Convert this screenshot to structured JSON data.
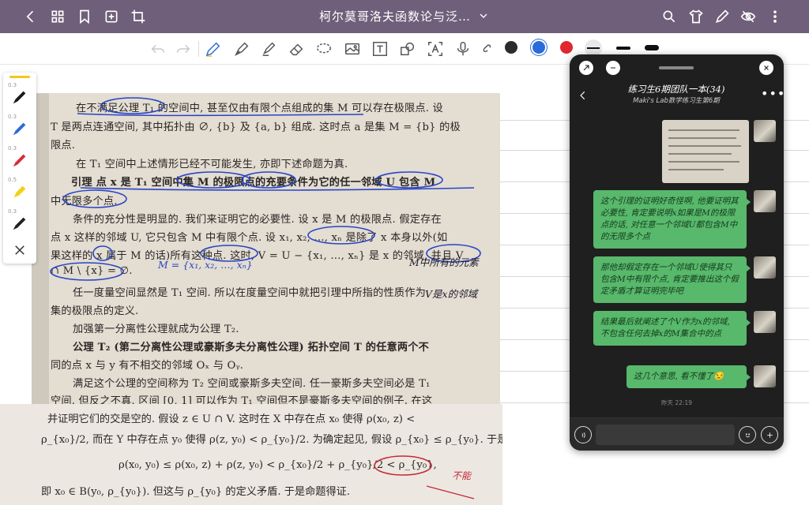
{
  "app": {
    "document_title": "柯尔莫哥洛夫函数论与泛…"
  },
  "toolbar": {
    "colors": [
      {
        "name": "black",
        "hex": "#2b2b2b"
      },
      {
        "name": "blue",
        "hex": "#2a6bd9",
        "selected": true
      },
      {
        "name": "red",
        "hex": "#e0262f"
      }
    ]
  },
  "page1": {
    "lines": [
      "在不满足公理 T₁ 的空间中, 甚至仅由有限个点组成的集 M 可以存在极限点. 设",
      "T 是两点连通空间, 其中拓扑由 ∅, {b} 及 {a, b} 组成. 这时点 a 是集 M = {b} 的极",
      "限点.",
      "在 T₁ 空间中上述情形已经不可能发生, 亦即下述命题为真.",
      "引理   点 x 是 T₁ 空间中集 M 的极限点的充要条件为它的任一邻域 U 包含 M",
      "中无限多个点.",
      "条件的充分性是明显的. 我们来证明它的必要性. 设 x 是 M 的极限点. 假定存在",
      "点 x 这样的邻域 U, 它只包含 M 中有限个点. 设 x₁, x₂, …, xₙ 是除了 x 本身以外(如",
      "果这样的 x 属于 M 的话)所有这种点. 这时, V = U − {x₁, …, xₙ} 是 x 的邻域, 并且 V",
      "∩ M \\ {x} = ∅.",
      "任一度量空间显然是 T₁ 空间. 所以在度量空间中就把引理中所指的性质作为",
      "集的极限点的定义.",
      "加强第一分离性公理就成为公理 T₂.",
      "公理 T₂ (第二分离性公理或豪斯多夫分离性公理)   拓扑空间 T 的任意两个不",
      "同的点 x 与 y 有不相交的邻域 Oₓ 与 Oᵧ.",
      "满足这个公理的空间称为 T₂ 空间或豪斯多夫空间. 任一豪斯多夫空间必是 T₁",
      "空间. 但反之不真. 区间 [0, 1] 可以作为 T₁ 空间但不是豪斯多夫空间的例子. 在这"
    ],
    "handwritten": [
      "M = {x₁, x₂, …, xₙ}",
      "M中所有的元素",
      "V是x的邻域"
    ]
  },
  "page2": {
    "lines": [
      "并证明它们的交是空的. 假设 z ∈ U ∩ V. 这时在 X 中存在点 x₀ 使得 ρ(x₀, z) <",
      "ρ_{x₀}/2, 而在 Y 中存在点 y₀ 使得 ρ(z, y₀) < ρ_{y₀}/2. 为确定起见, 假设 ρ_{x₀} ≤ ρ_{y₀}. 于是",
      "ρ(x₀, y₀) ≤ ρ(x₀, z) + ρ(z, y₀) < ρ_{x₀}/2 + ρ_{y₀}/2 < ρ_{y₀},",
      "即 x₀ ∈ B(y₀, ρ_{y₀}). 但这与 ρ_{y₀} 的定义矛盾. 于是命题得证."
    ],
    "handwritten_red": "不能"
  },
  "chat": {
    "title": "练习生6期团队一本(34)",
    "subtitle": "Maki's Lab数学练习生第6期",
    "messages": [
      "这个引理的证明好奇怪啊, 他要证明其必要性, 肯定要说明x如果是M的极限点的话, 对任意一个邻域U都包含M中的无限多个点",
      "那他却假定存在一个邻域U使得其只包含M中有限个点, 肯定要推出这个假定矛盾才算证明完毕吧",
      "结果最后就阐述了个V作为x的邻域, 不包含任何去掉x的M集合中的点",
      "这几个意思, 看不懂了😒"
    ],
    "timestamp": "昨天 22:19"
  }
}
